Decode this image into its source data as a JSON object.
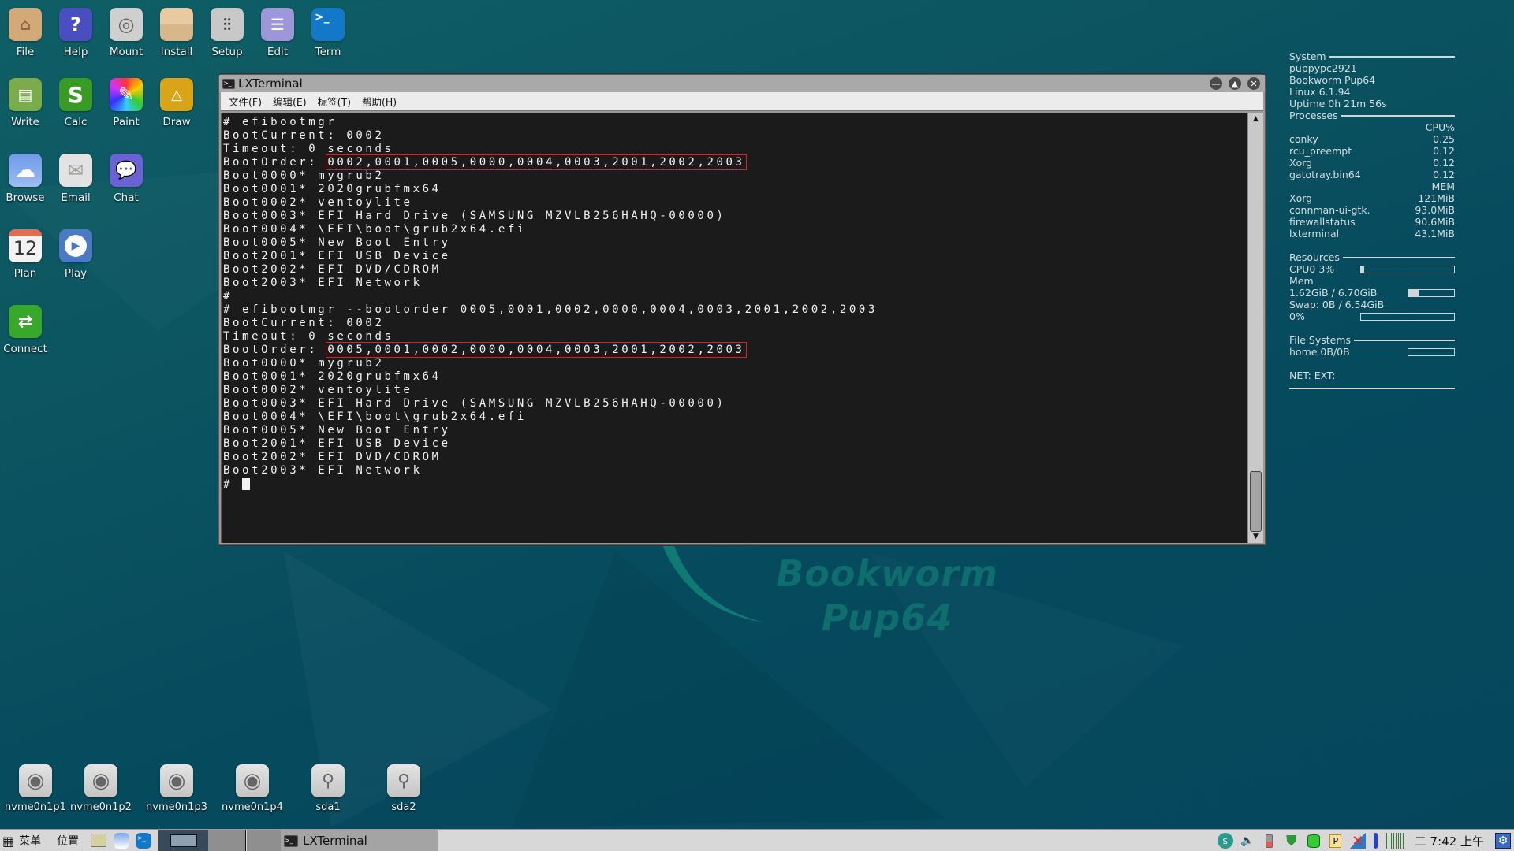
{
  "desktop": {
    "icons": [
      {
        "label": "File",
        "icon": "home-folder-icon"
      },
      {
        "label": "Help",
        "icon": "help-icon"
      },
      {
        "label": "Mount",
        "icon": "drive-icon"
      },
      {
        "label": "Install",
        "icon": "package-icon"
      },
      {
        "label": "Setup",
        "icon": "sliders-icon"
      },
      {
        "label": "Edit",
        "icon": "text-editor-icon"
      },
      {
        "label": "Term",
        "icon": "terminal-icon"
      },
      {
        "label": "Write",
        "icon": "document-icon"
      },
      {
        "label": "Calc",
        "icon": "spreadsheet-icon"
      },
      {
        "label": "Paint",
        "icon": "paintbrush-icon"
      },
      {
        "label": "Draw",
        "icon": "draw-icon"
      },
      {
        "label": "Browse",
        "icon": "cloud-icon"
      },
      {
        "label": "Email",
        "icon": "envelope-icon"
      },
      {
        "label": "Chat",
        "icon": "chat-bubble-icon"
      },
      {
        "label": "Plan",
        "icon": "calendar-icon",
        "glyph_text": "12"
      },
      {
        "label": "Play",
        "icon": "play-icon"
      },
      {
        "label": "Connect",
        "icon": "connect-arrows-icon"
      }
    ],
    "drives": [
      {
        "label": "nvme0n1p1",
        "icon": "hard-drive-icon"
      },
      {
        "label": "nvme0n1p2",
        "icon": "hard-drive-icon"
      },
      {
        "label": "nvme0n1p3",
        "icon": "hard-drive-icon"
      },
      {
        "label": "nvme0n1p4",
        "icon": "hard-drive-icon"
      },
      {
        "label": "sda1",
        "icon": "usb-icon"
      },
      {
        "label": "sda2",
        "icon": "usb-icon"
      }
    ],
    "wallpaper_text": [
      "Bookworm",
      "Pup64"
    ]
  },
  "terminal": {
    "title": "LXTerminal",
    "menu": [
      "文件(F)",
      "编辑(E)",
      "标签(T)",
      "帮助(H)"
    ],
    "lines": [
      {
        "text": "# efibootmgr"
      },
      {
        "text": "BootCurrent: 0002"
      },
      {
        "text": "Timeout: 0 seconds"
      },
      {
        "prefix": "BootOrder: ",
        "highlight": "0002,0001,0005,0000,0004,0003,2001,2002,2003"
      },
      {
        "text": "Boot0000* mygrub2"
      },
      {
        "text": "Boot0001* 2020grubfmx64"
      },
      {
        "text": "Boot0002* ventoylite"
      },
      {
        "text": "Boot0003* EFI Hard Drive (SAMSUNG MZVLB256HAHQ-00000)"
      },
      {
        "text": "Boot0004* \\EFI\\boot\\grub2x64.efi"
      },
      {
        "text": "Boot0005* New Boot Entry"
      },
      {
        "text": "Boot2001* EFI USB Device"
      },
      {
        "text": "Boot2002* EFI DVD/CDROM"
      },
      {
        "text": "Boot2003* EFI Network"
      },
      {
        "text": "#"
      },
      {
        "text": "# efibootmgr --bootorder 0005,0001,0002,0000,0004,0003,2001,2002,2003"
      },
      {
        "text": "BootCurrent: 0002"
      },
      {
        "text": "Timeout: 0 seconds"
      },
      {
        "prefix": "BootOrder: ",
        "highlight": "0005,0001,0002,0000,0004,0003,2001,2002,2003"
      },
      {
        "text": "Boot0000* mygrub2"
      },
      {
        "text": "Boot0001* 2020grubfmx64"
      },
      {
        "text": "Boot0002* ventoylite"
      },
      {
        "text": "Boot0003* EFI Hard Drive (SAMSUNG MZVLB256HAHQ-00000)"
      },
      {
        "text": "Boot0004* \\EFI\\boot\\grub2x64.efi"
      },
      {
        "text": "Boot0005* New Boot Entry"
      },
      {
        "text": "Boot2001* EFI USB Device"
      },
      {
        "text": "Boot2002* EFI DVD/CDROM"
      },
      {
        "text": "Boot2003* EFI Network"
      },
      {
        "text": "# ",
        "cursor": true
      }
    ]
  },
  "conky": {
    "system_header": "System",
    "hostname": "puppypc2921",
    "distro": "Bookworm Pup64",
    "kernel": "Linux 6.1.94",
    "uptime": "Uptime 0h 21m 56s",
    "processes_header": "Processes",
    "cpu_col": "CPU%",
    "cpu_procs": [
      {
        "name": "conky",
        "value": "0.25"
      },
      {
        "name": "rcu_preempt",
        "value": "0.12"
      },
      {
        "name": "Xorg",
        "value": "0.12"
      },
      {
        "name": "gatotray.bin64",
        "value": "0.12"
      }
    ],
    "mem_col": "MEM",
    "mem_procs": [
      {
        "name": "Xorg",
        "value": "121MiB"
      },
      {
        "name": "connman-ui-gtk.",
        "value": "93.0MiB"
      },
      {
        "name": "firewallstatus",
        "value": "90.6MiB"
      },
      {
        "name": "lxterminal",
        "value": "43.1MiB"
      }
    ],
    "resources_header": "Resources",
    "cpu_label": "CPU0 3%",
    "cpu_fraction": 0.03,
    "mem_label": "Mem",
    "mem_value": "1.62GiB / 6.70GiB",
    "mem_fraction": 0.24,
    "swap_label": "Swap: 0B / 6.54GiB",
    "swap_percent": "0%",
    "swap_fraction": 0.0,
    "fs_header": "File Systems",
    "home_label": "home 0B/0B",
    "home_fraction": 0.0,
    "net_label": "NET: EXT:"
  },
  "taskbar": {
    "menu_label": "菜单",
    "places_label": "位置",
    "task_label": "LXTerminal",
    "clock": "二 7:42 上午",
    "tray_icons": [
      "network-icon",
      "volume-icon",
      "battery-icon",
      "firewall-shield-icon",
      "disk-usage-icon",
      "clipboard-icon",
      "network-disconnected-icon",
      "temperature-icon",
      "cpu-graph-icon"
    ]
  }
}
